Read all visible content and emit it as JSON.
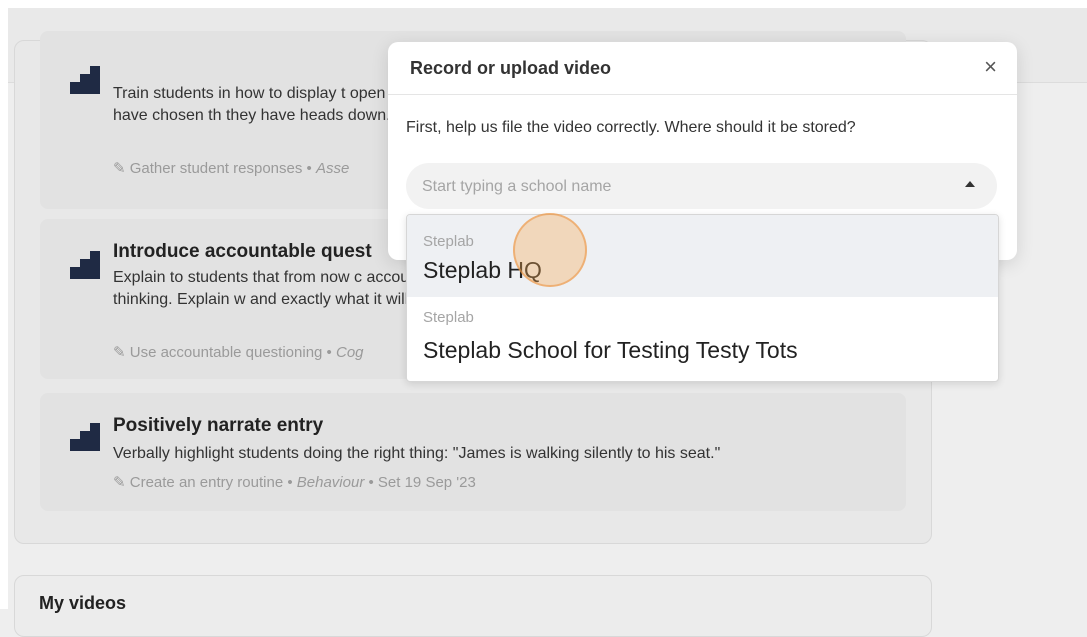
{
  "background": {
    "cards": [
      {
        "title": "",
        "description": "Train students in how to display t open hand if they have chosen th they have heads down.",
        "meta_tag": "Gather student responses",
        "meta_category": "Asse",
        "meta_date": ""
      },
      {
        "title": "Introduce accountable quest",
        "description": "Explain to students that from now c accountable for thinking. Explain w and exactly what it will look like",
        "meta_tag": "Use accountable questioning",
        "meta_category": "Cog",
        "meta_date": ""
      },
      {
        "title": "Positively narrate entry",
        "description": "Verbally highlight students doing the right thing: \"James is walking silently to his seat.\"",
        "meta_tag": "Create an entry routine",
        "meta_category": "Behaviour",
        "meta_date": "Set 19 Sep '23"
      }
    ],
    "videos_title": "My videos"
  },
  "modal": {
    "title": "Record or upload video",
    "close_glyph": "×",
    "prompt": "First, help us file the video correctly. Where should it be stored?",
    "search": {
      "placeholder": "Start typing a school name",
      "value": ""
    },
    "options": [
      {
        "group": "Steplab",
        "label": "Steplab HQ",
        "highlighted": true
      },
      {
        "group": "Steplab",
        "label": "Steplab School for Testing Testy Tots",
        "highlighted": false
      }
    ]
  },
  "colors": {
    "icon": "#1f2a44",
    "highlight": "#eef0f3",
    "cursor": "#f7a854"
  }
}
